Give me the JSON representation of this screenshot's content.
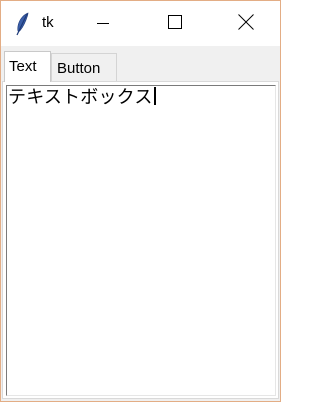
{
  "window": {
    "title": "tk",
    "icon": "feather-icon",
    "controls": {
      "minimize_icon": "minimize-icon",
      "maximize_icon": "maximize-icon",
      "close_icon": "close-icon"
    },
    "border_color": "#e3ad85"
  },
  "tabs": [
    {
      "label": "Text",
      "active": true
    },
    {
      "label": "Button",
      "active": false
    }
  ],
  "textbox": {
    "value": "テキストボックス"
  }
}
